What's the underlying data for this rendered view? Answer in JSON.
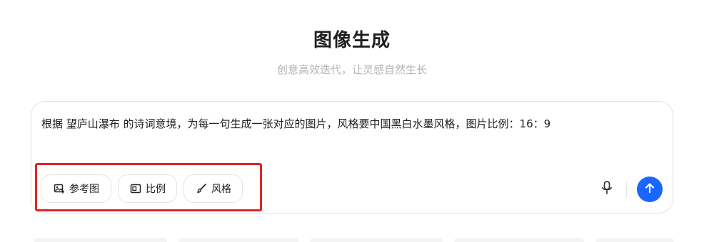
{
  "header": {
    "title": "图像生成",
    "subtitle": "创意高效迭代，让灵感自然生长"
  },
  "prompt": {
    "text": "根据 望庐山瀑布 的诗词意境，为每一句生成一张对应的图片，风格要中国黑白水墨风格，图片比例：16：9"
  },
  "toolbar": {
    "reference_label": "参考图",
    "ratio_label": "比例",
    "style_label": "风格"
  },
  "colors": {
    "accent": "#1a66ff",
    "highlight": "#e02424"
  },
  "icons": {
    "reference": "image-plus-icon",
    "ratio": "aspect-ratio-icon",
    "style": "brush-icon",
    "voice": "microphone-icon",
    "send": "arrow-up-icon"
  }
}
